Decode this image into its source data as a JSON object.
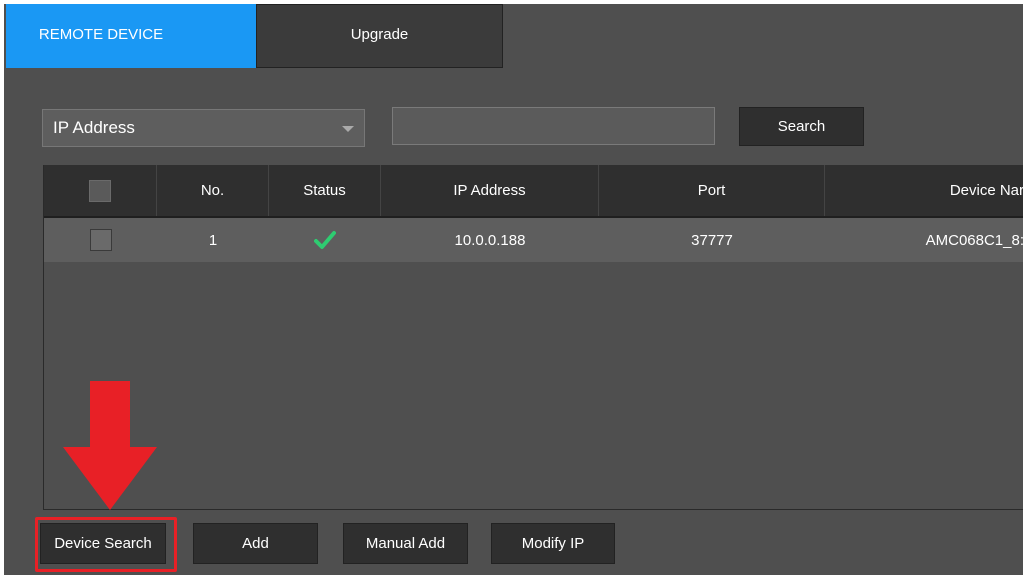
{
  "tabs": [
    {
      "label": "REMOTE DEVICE",
      "active": true
    },
    {
      "label": "Upgrade",
      "active": false
    }
  ],
  "search": {
    "filter_selected": "IP Address",
    "input_value": "",
    "button_label": "Search"
  },
  "table": {
    "columns": [
      "",
      "No.",
      "Status",
      "IP Address",
      "Port",
      "Device Nar"
    ],
    "rows": [
      {
        "no": "1",
        "status": "online-check-icon",
        "ip": "10.0.0.188",
        "port": "37777",
        "device_name": "AMC068C1_8:"
      }
    ]
  },
  "buttons": {
    "device_search": "Device Search",
    "add": "Add",
    "manual_add": "Manual Add",
    "modify_ip": "Modify IP"
  },
  "colors": {
    "active_tab": "#1a98f4",
    "status_ok": "#2ecc71",
    "annotation": "#e82026"
  }
}
